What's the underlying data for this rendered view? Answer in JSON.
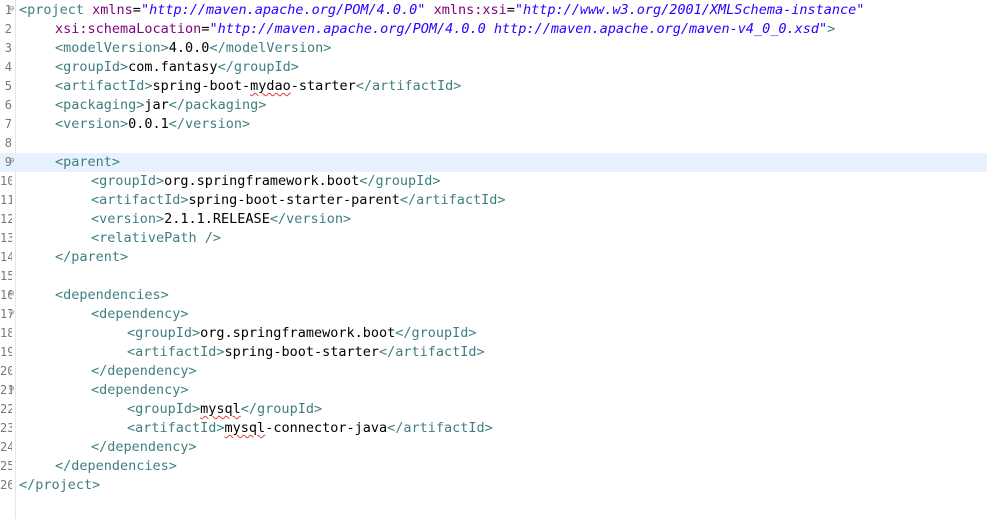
{
  "editor": {
    "lines": [
      {
        "num": "1",
        "fold": true,
        "segments": [
          {
            "t": "tag",
            "v": "<project "
          },
          {
            "t": "attr",
            "v": "xmlns"
          },
          {
            "t": "txt",
            "v": "="
          },
          {
            "t": "val",
            "v": "\"http://maven.apache.org/POM/4.0.0\""
          },
          {
            "t": "txt",
            "v": " "
          },
          {
            "t": "attr",
            "v": "xmlns:xsi"
          },
          {
            "t": "txt",
            "v": "="
          },
          {
            "t": "val",
            "v": "\"http://www.w3.org/2001/XMLSchema-instance\""
          }
        ]
      },
      {
        "num": "2",
        "indent": 1,
        "segments": [
          {
            "t": "attr",
            "v": "xsi:schemaLocation"
          },
          {
            "t": "txt",
            "v": "="
          },
          {
            "t": "val",
            "v": "\"http://maven.apache.org/POM/4.0.0 http://maven.apache.org/maven-v4_0_0.xsd\""
          },
          {
            "t": "tag",
            "v": ">"
          }
        ]
      },
      {
        "num": "3",
        "indent": 1,
        "segments": [
          {
            "t": "tag",
            "v": "<modelVersion>"
          },
          {
            "t": "txt",
            "v": "4.0.0"
          },
          {
            "t": "tag",
            "v": "</modelVersion>"
          }
        ]
      },
      {
        "num": "4",
        "indent": 1,
        "segments": [
          {
            "t": "tag",
            "v": "<groupId>"
          },
          {
            "t": "txt",
            "v": "com.fantasy"
          },
          {
            "t": "tag",
            "v": "</groupId>"
          }
        ]
      },
      {
        "num": "5",
        "indent": 1,
        "segments": [
          {
            "t": "tag",
            "v": "<artifactId>"
          },
          {
            "t": "txt",
            "v": "spring-boot-"
          },
          {
            "t": "txt",
            "v": "mydao",
            "sq": true
          },
          {
            "t": "txt",
            "v": "-starter"
          },
          {
            "t": "tag",
            "v": "</artifactId>"
          }
        ]
      },
      {
        "num": "6",
        "indent": 1,
        "segments": [
          {
            "t": "tag",
            "v": "<packaging>"
          },
          {
            "t": "txt",
            "v": "jar"
          },
          {
            "t": "tag",
            "v": "</packaging>"
          }
        ]
      },
      {
        "num": "7",
        "indent": 1,
        "segments": [
          {
            "t": "tag",
            "v": "<version>"
          },
          {
            "t": "txt",
            "v": "0.0.1"
          },
          {
            "t": "tag",
            "v": "</version>"
          }
        ]
      },
      {
        "num": "8",
        "segments": []
      },
      {
        "num": "9",
        "fold": true,
        "current": true,
        "indent": 1,
        "segments": [
          {
            "t": "tag",
            "v": "<parent>"
          }
        ]
      },
      {
        "num": "10",
        "indent": 2,
        "segments": [
          {
            "t": "tag",
            "v": "<groupId>"
          },
          {
            "t": "txt",
            "v": "org.springframework.boot"
          },
          {
            "t": "tag",
            "v": "</groupId>"
          }
        ]
      },
      {
        "num": "11",
        "indent": 2,
        "segments": [
          {
            "t": "tag",
            "v": "<artifactId>"
          },
          {
            "t": "txt",
            "v": "spring-boot-starter-parent"
          },
          {
            "t": "tag",
            "v": "</artifactId>"
          }
        ]
      },
      {
        "num": "12",
        "indent": 2,
        "segments": [
          {
            "t": "tag",
            "v": "<version>"
          },
          {
            "t": "txt",
            "v": "2.1.1.RELEASE"
          },
          {
            "t": "tag",
            "v": "</version>"
          }
        ]
      },
      {
        "num": "13",
        "indent": 2,
        "segments": [
          {
            "t": "tag",
            "v": "<relativePath />"
          }
        ]
      },
      {
        "num": "14",
        "indent": 1,
        "segments": [
          {
            "t": "tag",
            "v": "</parent>"
          }
        ]
      },
      {
        "num": "15",
        "segments": []
      },
      {
        "num": "16",
        "fold": true,
        "indent": 1,
        "segments": [
          {
            "t": "tag",
            "v": "<dependencies>"
          }
        ]
      },
      {
        "num": "17",
        "fold": true,
        "indent": 2,
        "segments": [
          {
            "t": "tag",
            "v": "<dependency>"
          }
        ]
      },
      {
        "num": "18",
        "indent": 3,
        "segments": [
          {
            "t": "tag",
            "v": "<groupId>"
          },
          {
            "t": "txt",
            "v": "org.springframework.boot"
          },
          {
            "t": "tag",
            "v": "</groupId>"
          }
        ]
      },
      {
        "num": "19",
        "indent": 3,
        "segments": [
          {
            "t": "tag",
            "v": "<artifactId>"
          },
          {
            "t": "txt",
            "v": "spring-boot-starter"
          },
          {
            "t": "tag",
            "v": "</artifactId>"
          }
        ]
      },
      {
        "num": "20",
        "indent": 2,
        "segments": [
          {
            "t": "tag",
            "v": "</dependency>"
          }
        ]
      },
      {
        "num": "21",
        "fold": true,
        "indent": 2,
        "segments": [
          {
            "t": "tag",
            "v": "<dependency>"
          }
        ]
      },
      {
        "num": "22",
        "indent": 3,
        "segments": [
          {
            "t": "tag",
            "v": "<groupId>"
          },
          {
            "t": "txt",
            "v": "mysql",
            "sq": true
          },
          {
            "t": "tag",
            "v": "</groupId>"
          }
        ]
      },
      {
        "num": "23",
        "indent": 3,
        "segments": [
          {
            "t": "tag",
            "v": "<artifactId>"
          },
          {
            "t": "txt",
            "v": "mysql",
            "sq": true
          },
          {
            "t": "txt",
            "v": "-connector-java"
          },
          {
            "t": "tag",
            "v": "</artifactId>"
          }
        ]
      },
      {
        "num": "24",
        "indent": 2,
        "segments": [
          {
            "t": "tag",
            "v": "</dependency>"
          }
        ]
      },
      {
        "num": "25",
        "indent": 1,
        "segments": [
          {
            "t": "tag",
            "v": "</dependencies>"
          }
        ]
      },
      {
        "num": "26",
        "segments": [
          {
            "t": "tag",
            "v": "</project>"
          }
        ]
      }
    ]
  }
}
